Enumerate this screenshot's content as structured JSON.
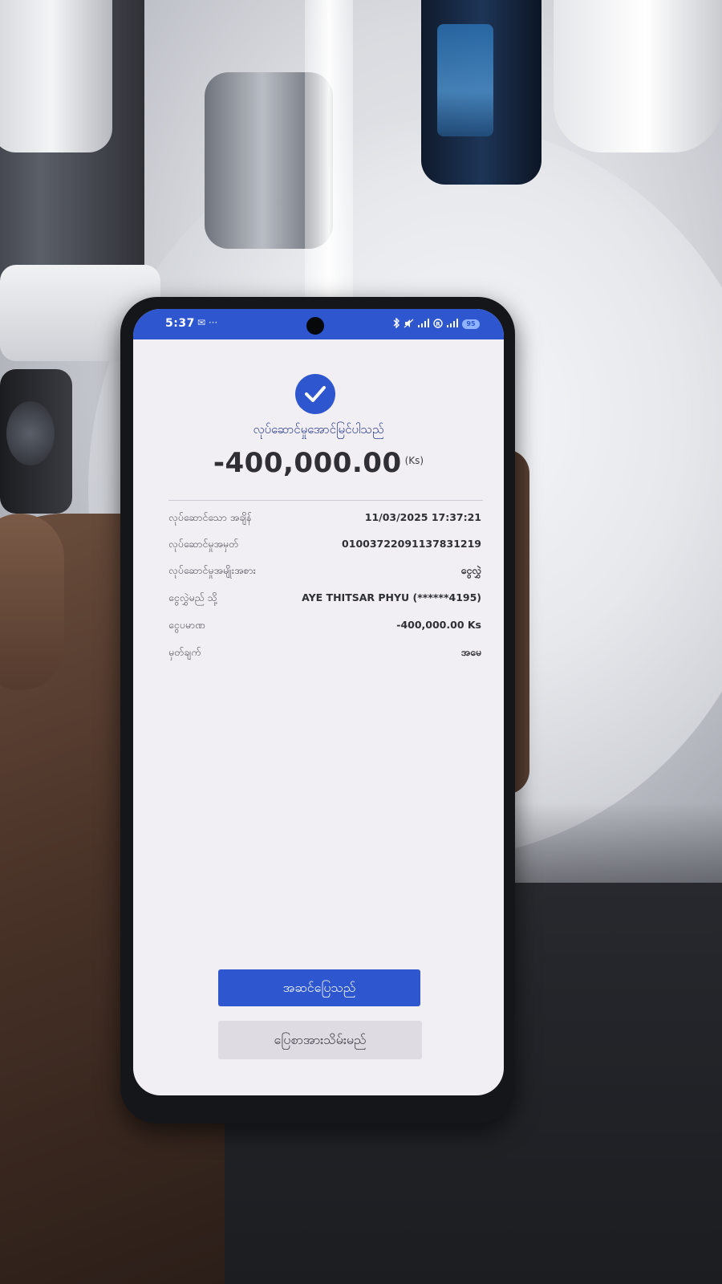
{
  "status_bar": {
    "time": "5:37",
    "notification_glyphs": "✉ ···",
    "icons": [
      "bluetooth-icon",
      "mute-icon",
      "signal-icon",
      "nfc-icon",
      "signal-icon"
    ],
    "battery": "95",
    "color": "#2d56cf"
  },
  "receipt": {
    "success_icon": "check-icon",
    "title": "လုပ်ဆောင်မှုအောင်မြင်ပါသည်",
    "amount": "-400,000.00",
    "currency": "(Ks)",
    "details": [
      {
        "label": "လုပ်ဆောင်သော အချိန်",
        "value": "11/03/2025 17:37:21"
      },
      {
        "label": "လုပ်ဆောင်မှုအမှတ်",
        "value": "01003722091137831219"
      },
      {
        "label": "လုပ်ဆောင်မှုအမျိုးအစား",
        "value": "ငွေလွှဲ"
      },
      {
        "label": "ငွေလွှဲမည် သို့",
        "value": "AYE THITSAR PHYU (******4195)"
      },
      {
        "label": "ငွေပမာဏ",
        "value": "-400,000.00 Ks"
      },
      {
        "label": "မှတ်ချက်",
        "value": "အမေ"
      }
    ]
  },
  "actions": {
    "done_label": "အဆင်ပြေသည်",
    "save_receipt_label": "ပြေစာအားသိမ်းမည်"
  },
  "colors": {
    "accent": "#2d56cf",
    "screen_bg": "#f1eef4",
    "secondary_button": "#dedbe2"
  }
}
